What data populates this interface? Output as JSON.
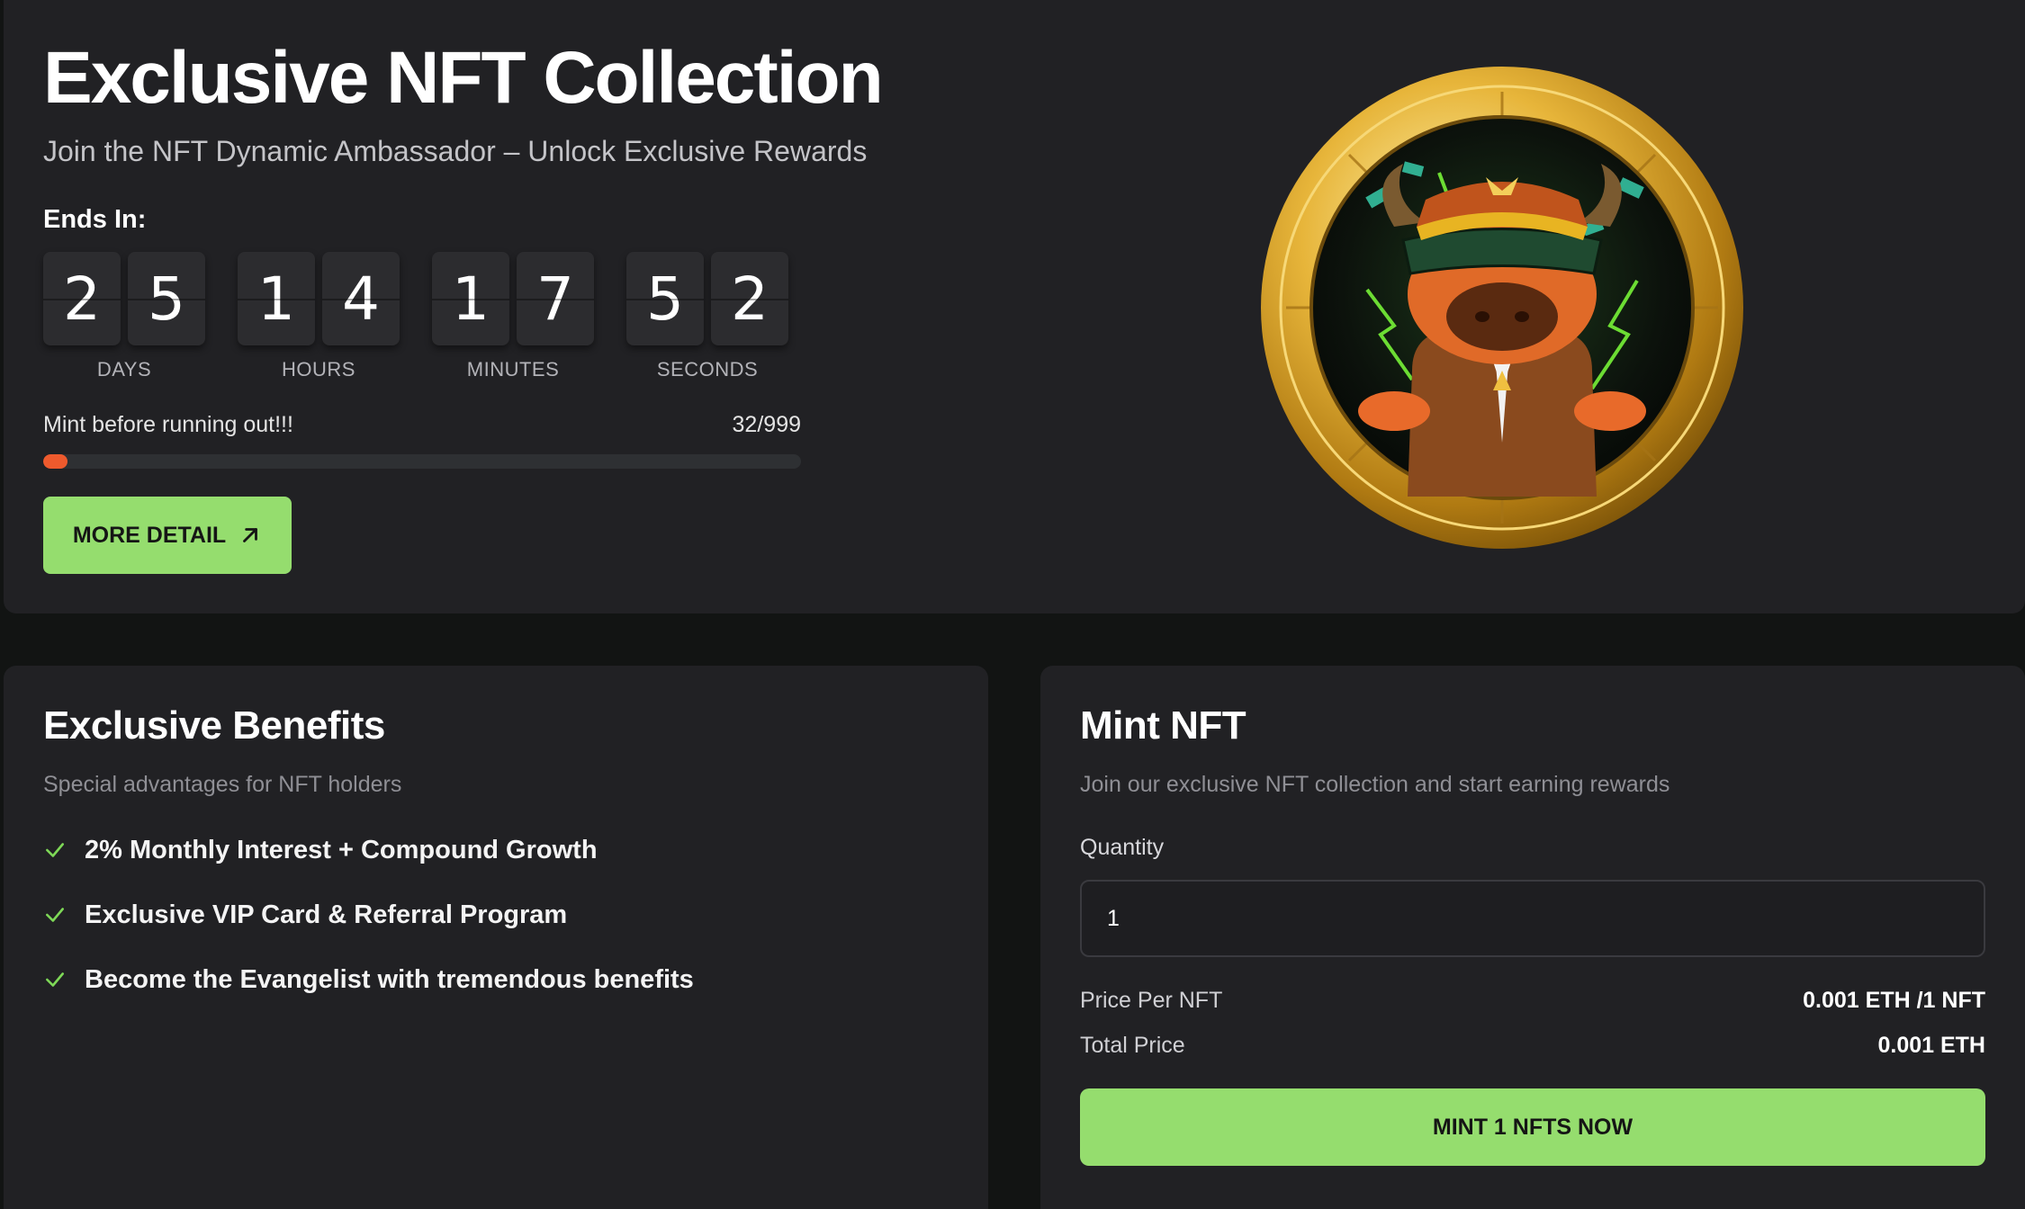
{
  "hero": {
    "title": "Exclusive NFT Collection",
    "subtitle": "Join the NFT Dynamic Ambassador – Unlock Exclusive Rewards",
    "ends_label": "Ends In:",
    "countdown": [
      {
        "label": "DAYS",
        "d1": "2",
        "d2": "5"
      },
      {
        "label": "HOURS",
        "d1": "1",
        "d2": "4"
      },
      {
        "label": "MINUTES",
        "d1": "1",
        "d2": "7"
      },
      {
        "label": "SECONDS",
        "d1": "5",
        "d2": "2"
      }
    ],
    "progress_label": "Mint before running out!!!",
    "progress_count": "32/999",
    "progress_fraction": 0.032,
    "more_button": "MORE DETAIL",
    "image_icon": "nft-bull-coin-image"
  },
  "benefits": {
    "title": "Exclusive Benefits",
    "subtitle": "Special advantages for NFT holders",
    "items": [
      "2% Monthly Interest + Compound Growth",
      "Exclusive VIP Card & Referral Program",
      "Become the Evangelist with tremendous benefits"
    ]
  },
  "mint": {
    "title": "Mint NFT",
    "subtitle": "Join our exclusive NFT collection and start earning rewards",
    "quantity_label": "Quantity",
    "quantity_value": "1",
    "price_per_label": "Price Per NFT",
    "price_per_value": "0.001 ETH /1 NFT",
    "total_label": "Total Price",
    "total_value": "0.001 ETH",
    "button": "MINT 1 NFTS NOW"
  },
  "colors": {
    "accent_green": "#95dd6e",
    "progress_orange": "#ee5a2d",
    "card_bg": "#212124",
    "page_bg": "#121413"
  }
}
